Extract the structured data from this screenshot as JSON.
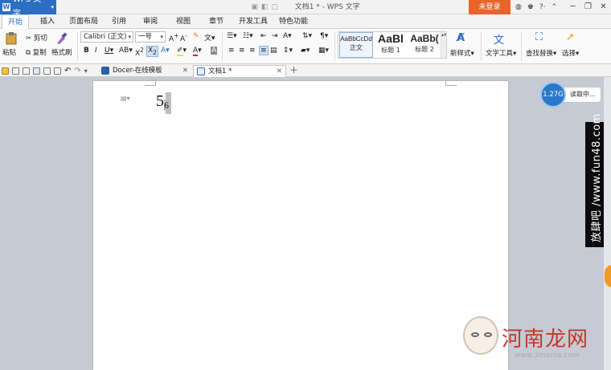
{
  "titlebar": {
    "app_name": "WPS 文字",
    "window_title": "文档1 * - WPS 文字",
    "login_label": "未登录",
    "accent_color": "#2b6ec4",
    "login_color": "#e8642a"
  },
  "menu_tabs": [
    "开始",
    "插入",
    "页面布局",
    "引用",
    "审阅",
    "视图",
    "章节",
    "开发工具",
    "特色功能"
  ],
  "ribbon": {
    "paste": "粘贴",
    "cut": "剪切",
    "copy": "复制",
    "format_painter": "格式刷",
    "font_name": "Calibri (正文)",
    "font_size": "一号",
    "style_normal_preview": "AaBbCcDd",
    "style_normal": "正文",
    "style_h1_preview": "AaBl",
    "style_h1": "标题 1",
    "style_h2_preview": "AaBb(",
    "style_h2": "标题 2",
    "new_style": "新样式",
    "text_tools": "文字工具",
    "find_replace": "查找替换",
    "select": "选择"
  },
  "doc_tabs": [
    {
      "label": "Docer-在线模板"
    },
    {
      "label": "文档1 *"
    }
  ],
  "document": {
    "base": "5",
    "subscript": "6"
  },
  "speed_widget": {
    "value": "1.27G",
    "label": "读取中..."
  },
  "side_banner": "放肆吧 /www.fun48.com",
  "watermark": {
    "text": "河南龙网",
    "url": "www.3mama.com"
  }
}
